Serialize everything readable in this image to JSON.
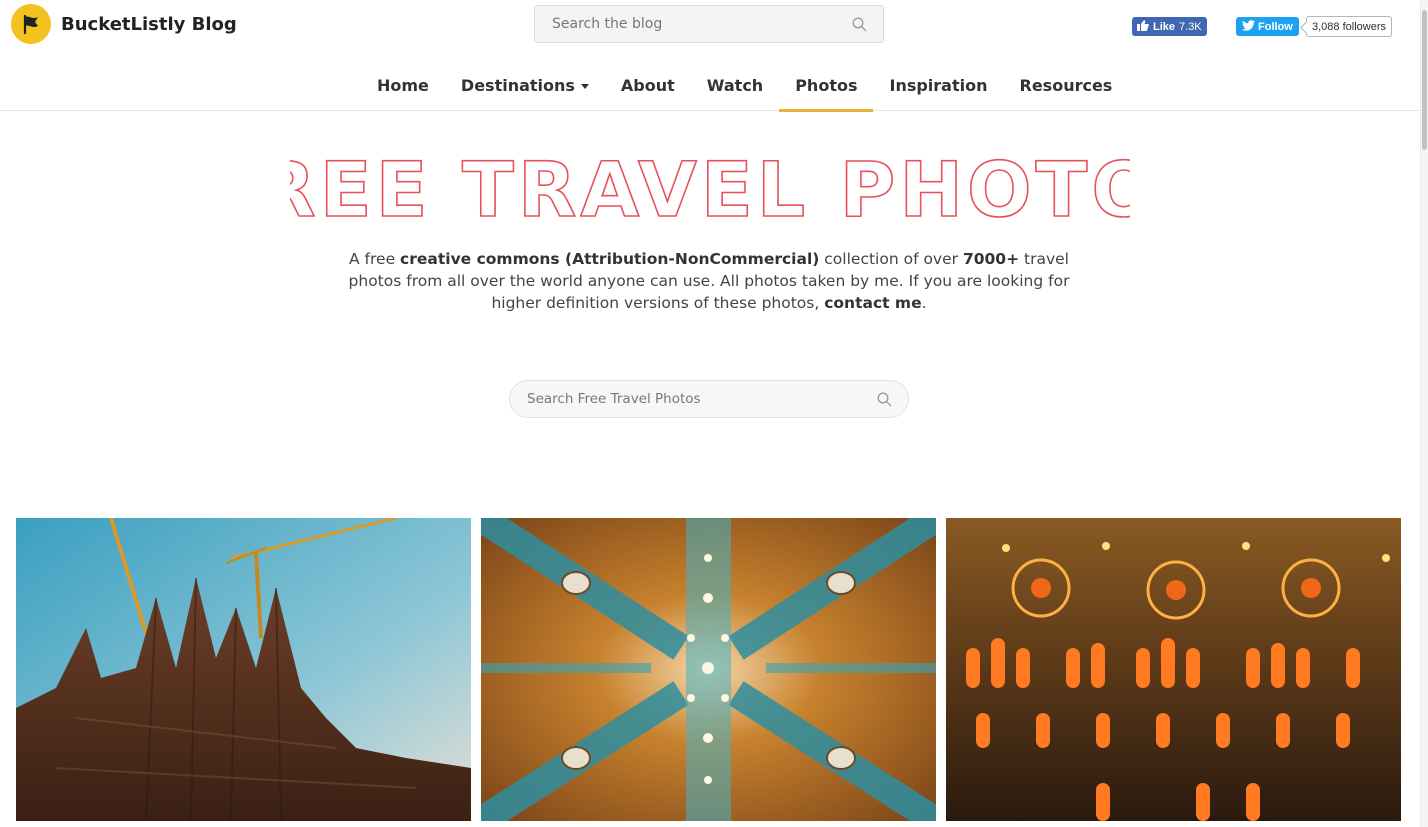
{
  "brand": {
    "name": "BucketListly Blog",
    "logo_icon": "flag-icon",
    "accent": "#f4c21f"
  },
  "header": {
    "search_placeholder": "Search the blog",
    "fb_like": {
      "label": "Like",
      "count": "7.3K"
    },
    "twitter": {
      "label": "Follow",
      "followers": "3,088 followers"
    }
  },
  "nav": {
    "items": [
      {
        "label": "Home"
      },
      {
        "label": "Destinations"
      },
      {
        "label": "About"
      },
      {
        "label": "Watch"
      },
      {
        "label": "Photos"
      },
      {
        "label": "Inspiration"
      },
      {
        "label": "Resources"
      }
    ],
    "active": "Photos",
    "active_color": "#e9b339"
  },
  "hero": {
    "title": "FREE TRAVEL PHOTOS",
    "title_color": "#e8505b",
    "intro": {
      "p1": "A free ",
      "b1": "creative commons (Attribution-NonCommercial)",
      "p2": " collection of over ",
      "b2": "7000+",
      "p3": " travel photos from all over the world anyone can use. All photos taken by me. If you are looking for higher definition versions of these photos, ",
      "b3": "contact me",
      "p4": "."
    }
  },
  "photo_search": {
    "placeholder": "Search Free Travel Photos"
  },
  "photos": [
    {
      "subject": "sagrada-familia-exterior"
    },
    {
      "subject": "sagrada-familia-ceiling"
    },
    {
      "subject": "sagrada-familia-stained-glass"
    }
  ]
}
